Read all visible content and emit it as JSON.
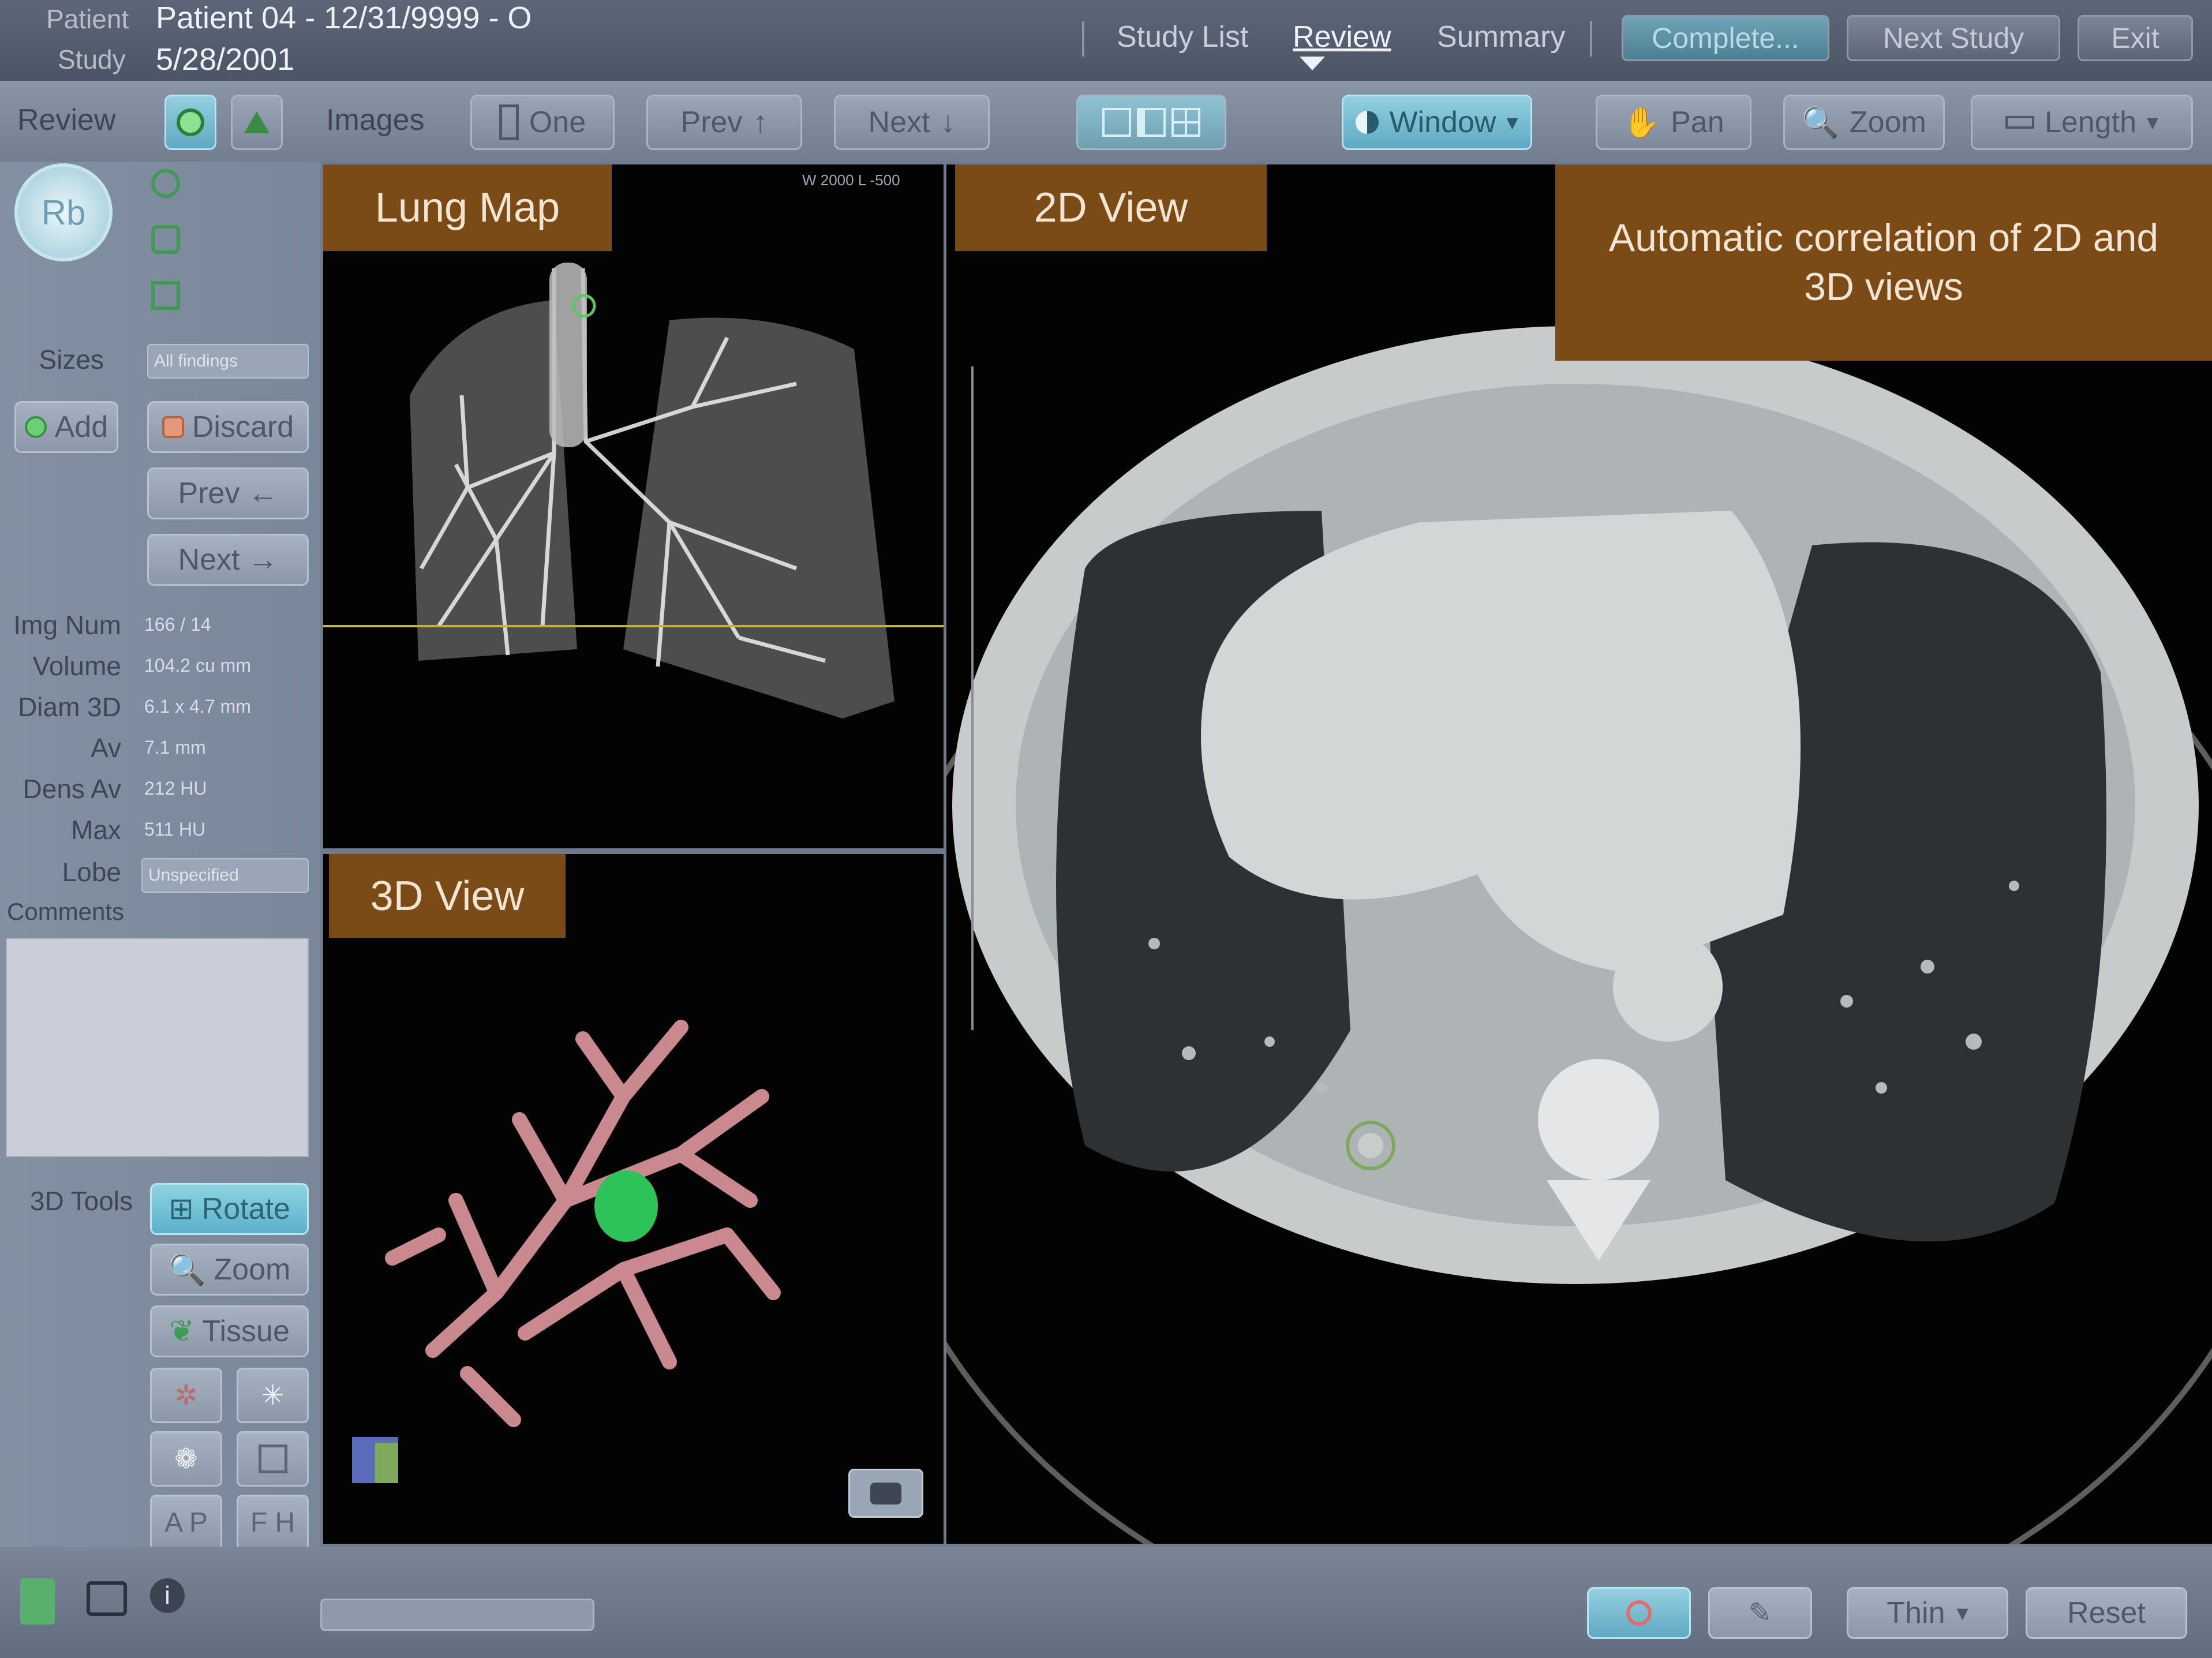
{
  "header": {
    "patient_label": "Patient",
    "patient_value": "Patient 04 - 12/31/9999 - O",
    "study_label": "Study",
    "study_value": "5/28/2001",
    "nav": [
      "Study List",
      "Review",
      "Summary"
    ],
    "buttons": [
      "Complete...",
      "Next Study",
      "Exit"
    ]
  },
  "toolbar": {
    "review_label": "Review",
    "images_label": "Images",
    "one_label": "One",
    "prev_label": "Prev",
    "next_label": "Next",
    "window_label": "Window",
    "pan_label": "Pan",
    "zoom_label": "Zoom",
    "length_label": "Length"
  },
  "sidebar": {
    "sizes_label": "Sizes",
    "sizes_value": "All findings",
    "add_label": "Add",
    "discard_label": "Discard",
    "prev_label": "Prev",
    "next_label": "Next",
    "rows": [
      {
        "label": "Img Num",
        "value": "166 / 14"
      },
      {
        "label": "Volume",
        "value": "104.2 cu mm"
      },
      {
        "label": "Diam 3D",
        "value": "6.1 x 4.7 mm"
      },
      {
        "label": "Av",
        "value": "7.1 mm"
      },
      {
        "label": "Dens Av",
        "value": "212 HU"
      },
      {
        "label": "Max",
        "value": "511 HU"
      }
    ],
    "lobe_label": "Lobe",
    "lobe_value": "Unspecified",
    "comments_label": "Comments",
    "tools_label": "3D Tools",
    "rotate_label": "Rotate",
    "zoom_label": "Zoom",
    "tissue_label": "Tissue",
    "ap_label": "A P",
    "fh_label": "F H"
  },
  "views": {
    "lung_map": "Lung Map",
    "three_d": "3D View",
    "two_d": "2D View",
    "correlation": "Automatic correlation of 2D and 3D views",
    "lung_map_info": "W 2000 L -500"
  },
  "bottom": {
    "thin_label": "Thin",
    "reset_label": "Reset"
  },
  "colors": {
    "accent": "#7a4a17",
    "active_button": "#5fa9c2",
    "nodule": "#2ec25a",
    "vessels": "#c9898f"
  }
}
